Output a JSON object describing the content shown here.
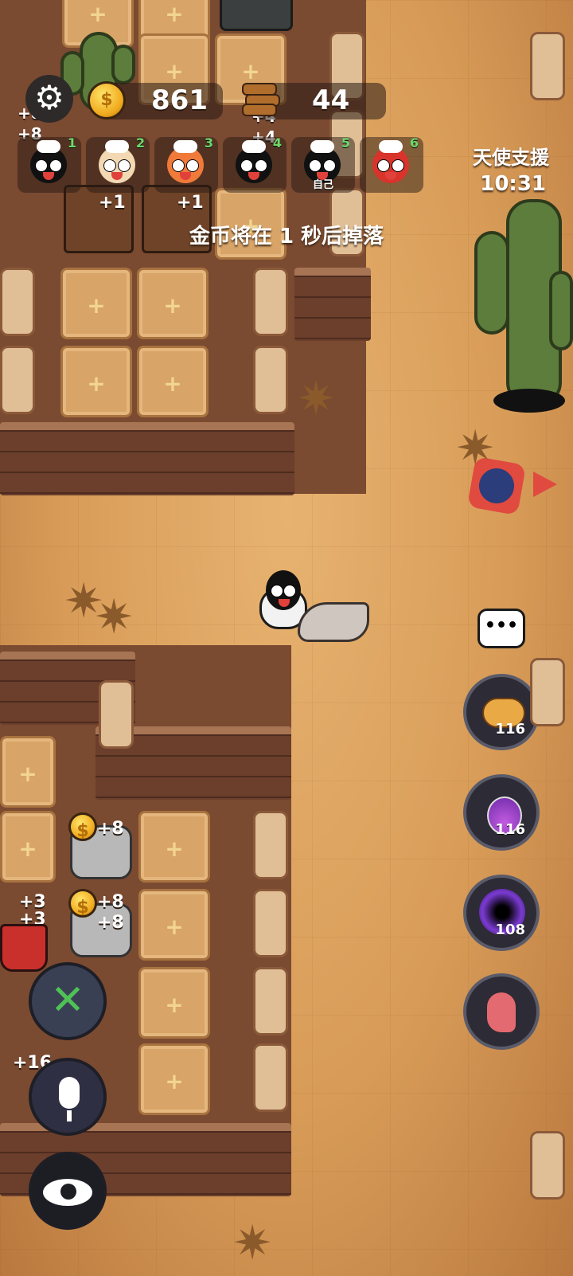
{
  "hud": {
    "coins": "861",
    "wood": "44",
    "settings_icon": "gear-icon",
    "coin_icon": "coin-icon",
    "wood_icon": "logs-icon"
  },
  "players": [
    {
      "num": "1",
      "avatar": "black-sheep-avatar",
      "sub": ""
    },
    {
      "num": "2",
      "avatar": "white-sheep-avatar",
      "sub": ""
    },
    {
      "num": "3",
      "avatar": "tiger-sheep-avatar",
      "sub": ""
    },
    {
      "num": "4",
      "avatar": "black-sheep-avatar",
      "sub": ""
    },
    {
      "num": "5",
      "avatar": "black-sheep-avatar",
      "sub": "自己"
    },
    {
      "num": "6",
      "avatar": "red-hood-sheep-avatar",
      "sub": ""
    }
  ],
  "angel": {
    "label": "天使支援",
    "timer": "10:31"
  },
  "notice": "金币将在 1 秒后掉落",
  "map_labels": {
    "log_plus_a": "+1",
    "log_plus_b": "+1",
    "top_plus_a": "+8",
    "top_plus_b": "+8",
    "top_plus_c": "+4",
    "top_plus_d": "+4",
    "ore_a": "+8",
    "ore_b": "+8",
    "ore_c": "+8",
    "left_a": "+3",
    "left_b": "+3",
    "left_c": "+16"
  },
  "side_buttons": [
    {
      "name": "piggy-bank-button",
      "icon": "piggy-bank-icon",
      "count": "116"
    },
    {
      "name": "potion-button",
      "icon": "potion-icon",
      "count": "116"
    },
    {
      "name": "vortex-button",
      "icon": "vortex-icon",
      "count": "108"
    },
    {
      "name": "ghost-button",
      "icon": "ghost-icon",
      "count": ""
    }
  ],
  "bottom_buttons": [
    "build-button",
    "voice-button",
    "view-button"
  ],
  "colors": {
    "sand": "#d9a25e",
    "wall": "#6b3f2c",
    "green_num": "#6dd86a",
    "accent_red": "#e04a3f"
  }
}
